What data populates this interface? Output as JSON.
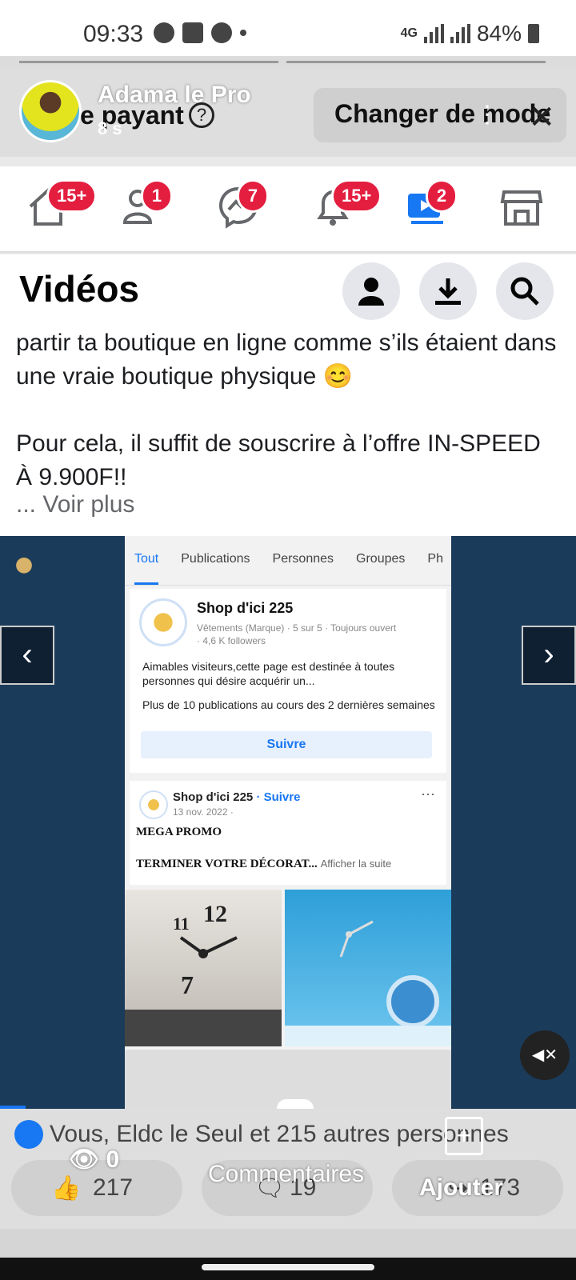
{
  "status_bar": {
    "time": "09:33",
    "network": "4G",
    "battery": "84%"
  },
  "story": {
    "user_name": "Adama le Pro",
    "ghost_title": "e payant",
    "age": "8 s",
    "mode_button": "Changer de mode"
  },
  "tabs": [
    {
      "name": "home",
      "badge": "15+"
    },
    {
      "name": "friends",
      "badge": "1"
    },
    {
      "name": "messenger",
      "badge": "7"
    },
    {
      "name": "notifications",
      "badge": "15+"
    },
    {
      "name": "video",
      "badge": "2"
    },
    {
      "name": "marketplace",
      "badge": ""
    }
  ],
  "content": {
    "title": "Vidéos",
    "post_text_1": "partir ta boutique en ligne comme s’ils étaient dans une vraie boutique physique 😊",
    "post_text_2": "Pour cela, il suffit de souscrire à l’offre IN-SPEED À 9.900F!!",
    "see_more": "... Voir plus"
  },
  "video": {
    "tabs": [
      "Tout",
      "Publications",
      "Personnes",
      "Groupes",
      "Ph"
    ],
    "page_name": "Shop d'ici 225",
    "page_meta": "Vêtements (Marque) · 5 sur 5 · Toujours ouvert",
    "followers": "· 4,6 K followers",
    "info_1": "Aimables visiteurs,cette page est destinée à toutes personnes qui désire acquérir un...",
    "info_2": "Plus de 10 publications au cours des 2 dernières semaines",
    "follow_button": "Suivre",
    "post_header": "Shop d'ici 225",
    "post_follow": "· Suivre",
    "post_date": "13 nov. 2022 ·",
    "post_title": "MEGA PROMO",
    "post_line": "TERMINER VOTRE DÉCORAT...",
    "post_more": "Afficher la suite",
    "mute_icon": "mute-icon"
  },
  "reactions": {
    "likes_line": "Vous, Eldc le Seul et 215 autres personnes",
    "like_count": "217",
    "comment_count": "19",
    "share_count": "173",
    "views": "0",
    "comment_label": "Commentaires",
    "add_label": "Ajouter"
  },
  "colors": {
    "fb_blue": "#1877f2",
    "badge_red": "#e41e3f",
    "video_bg": "#1b3b5a"
  }
}
